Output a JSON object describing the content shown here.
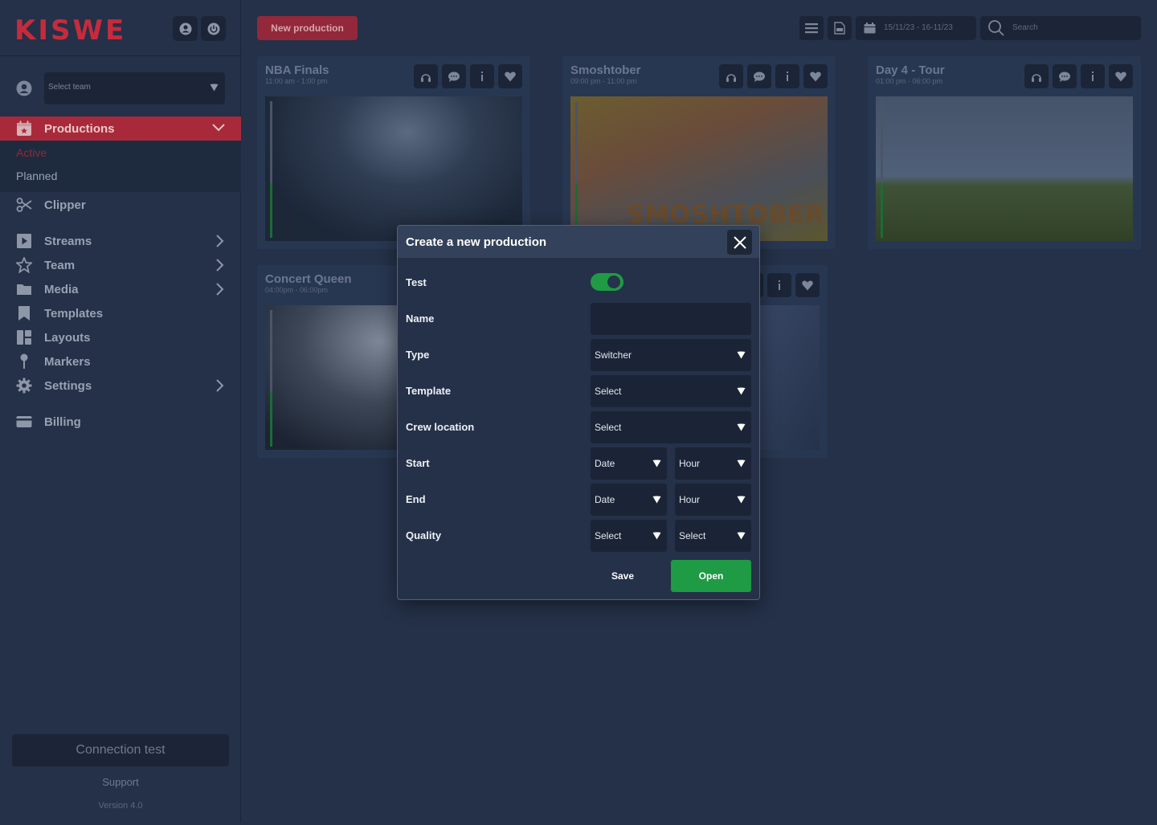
{
  "app": {
    "logo": "KISWE",
    "version": "Version 4.0",
    "support": "Support",
    "connection_test": "Connection test"
  },
  "sidebar": {
    "team_select_placeholder": "Select team",
    "productions": {
      "label": "Productions",
      "sub_items": [
        {
          "label": "Active",
          "active": true
        },
        {
          "label": "Planned",
          "active": false
        }
      ]
    },
    "items": [
      {
        "label": "Clipper",
        "icon": "scissors-icon",
        "has_submenu": false
      },
      {
        "label": "Streams",
        "icon": "play-icon",
        "has_submenu": true
      },
      {
        "label": "Team",
        "icon": "star-icon",
        "has_submenu": true
      },
      {
        "label": "Media",
        "icon": "folder-icon",
        "has_submenu": true
      },
      {
        "label": "Templates",
        "icon": "bookmark-icon",
        "has_submenu": false
      },
      {
        "label": "Layouts",
        "icon": "layout-icon",
        "has_submenu": false
      },
      {
        "label": "Markers",
        "icon": "pin-icon",
        "has_submenu": false
      },
      {
        "label": "Settings",
        "icon": "gear-icon",
        "has_submenu": true
      },
      {
        "label": "Billing",
        "icon": "credit-card-icon",
        "has_submenu": false
      }
    ]
  },
  "topbar": {
    "new_production": "New production",
    "date_range": "15/11/23 - 16-11/23",
    "search_placeholder": "Search"
  },
  "cards": [
    {
      "title": "NBA Finals",
      "time": "11:00 am - 1:00 pm",
      "level": 0.4
    },
    {
      "title": "Smoshtober",
      "time": "09:00 pm - 11:00 pm",
      "level": 0.4,
      "image_text": "SMOSHTOBER"
    },
    {
      "title": "Day 4 - Tour",
      "time": "01:00 pm - 06:00 pm",
      "level": 0.4
    },
    {
      "title": "Concert Queen",
      "time": "04:00pm - 06:00pm",
      "level": 0.4
    },
    {
      "title": "",
      "time": "",
      "level": 0.4
    }
  ],
  "modal": {
    "title": "Create a new production",
    "fields": {
      "test": {
        "label": "Test",
        "on": true
      },
      "name": {
        "label": "Name",
        "value": ""
      },
      "type": {
        "label": "Type",
        "value": "Switcher"
      },
      "template": {
        "label": "Template",
        "value": "Select"
      },
      "crew_location": {
        "label": "Crew location",
        "value": "Select"
      },
      "start": {
        "label": "Start",
        "date": "Date",
        "hour": "Hour"
      },
      "end": {
        "label": "End",
        "date": "Date",
        "hour": "Hour"
      },
      "quality": {
        "label": "Quality",
        "first": "Select",
        "second": "Select"
      }
    },
    "save": "Save",
    "open": "Open"
  },
  "colors": {
    "background": "#243148",
    "accent_red": "#a82a3a",
    "accent_green": "#1f9a45",
    "field_bg": "#1b2436"
  }
}
